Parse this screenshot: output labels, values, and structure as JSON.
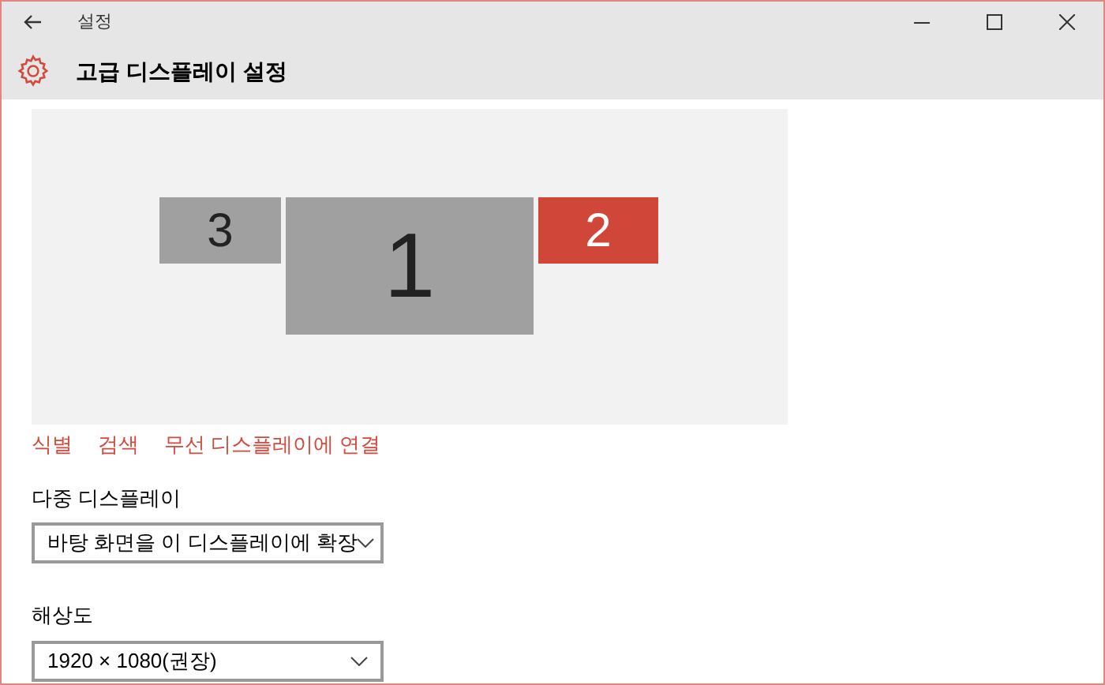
{
  "window": {
    "title": "설정"
  },
  "header": {
    "title": "고급 디스플레이 설정"
  },
  "monitors": [
    {
      "label": "3",
      "selected": false
    },
    {
      "label": "1",
      "selected": false
    },
    {
      "label": "2",
      "selected": true
    }
  ],
  "links": [
    "식별",
    "검색",
    "무선 디스플레이에 연결"
  ],
  "settings": [
    {
      "label": "다중 디스플레이",
      "value": "바탕 화면을 이 디스플레이에 확장"
    },
    {
      "label": "해상도",
      "value": "1920 × 1080(권장)"
    }
  ]
}
